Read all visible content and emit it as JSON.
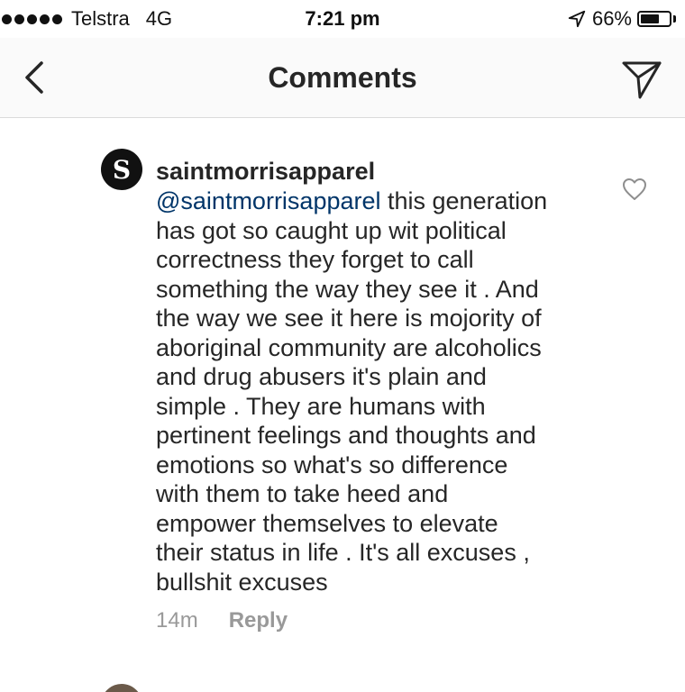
{
  "status_bar": {
    "carrier": "Telstra",
    "network": "4G",
    "time": "7:21 pm",
    "battery_percent": "66%",
    "battery_level": 0.66
  },
  "nav": {
    "title": "Comments",
    "back_icon": "chevron-left-icon",
    "direct_icon": "paper-plane-icon"
  },
  "comment": {
    "avatar_letter": "S",
    "username": "saintmorrisapparel",
    "mention": "@saintmorrisapparel",
    "lines": [
      " this generation",
      "has got so caught up wit political",
      "correctness they forget to call",
      "something the way they see it . And",
      "the way we see it here is mojority of",
      "aboriginal community are alcoholics",
      "and drug abusers it's plain and",
      "simple . They are humans with",
      "pertinent feelings and thoughts and",
      "emotions so what's so difference",
      "with them to take heed and",
      "empower themselves to elevate",
      "their status in life . It's all excuses ,",
      "bullshit excuses"
    ],
    "timestamp": "14m",
    "reply_label": "Reply",
    "like_icon": "heart-outline-icon"
  }
}
